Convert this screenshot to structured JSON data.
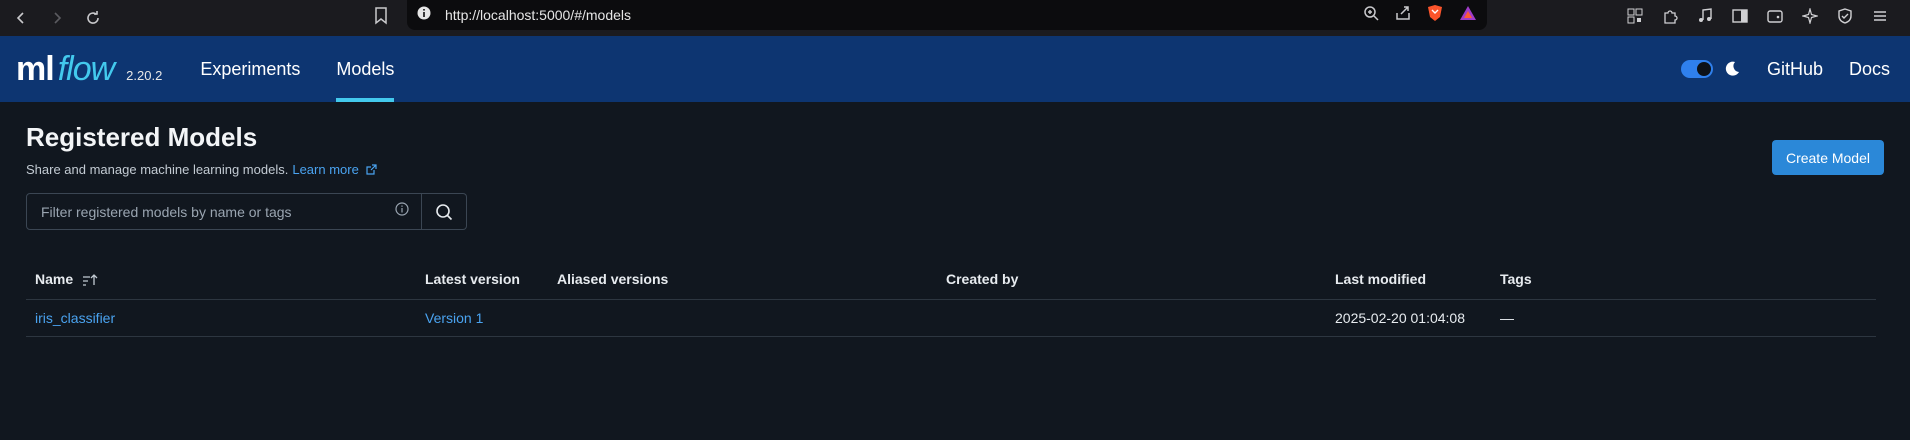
{
  "browser": {
    "url": "http://localhost:5000/#/models"
  },
  "header": {
    "logo_ml": "ml",
    "logo_flow": "flow",
    "version": "2.20.2",
    "nav": [
      {
        "label": "Experiments",
        "active": false
      },
      {
        "label": "Models",
        "active": true
      }
    ],
    "github": "GitHub",
    "docs": "Docs"
  },
  "page": {
    "title": "Registered Models",
    "subtitle": "Share and manage machine learning models.",
    "learn_more": "Learn more",
    "create_button": "Create Model",
    "search_placeholder": "Filter registered models by name or tags"
  },
  "table": {
    "columns": [
      "Name",
      "Latest version",
      "Aliased versions",
      "Created by",
      "Last modified",
      "Tags"
    ],
    "rows": [
      {
        "name": "iris_classifier",
        "latest_version": "Version 1",
        "aliased_versions": "",
        "created_by": "",
        "last_modified": "2025-02-20 01:04:08",
        "tags": "—"
      }
    ]
  },
  "colors": {
    "header_bg": "#0d3571",
    "accent": "#43c9ed",
    "link": "#4aa3f0",
    "primary_button": "#2b88d8",
    "page_bg": "#11171f"
  }
}
